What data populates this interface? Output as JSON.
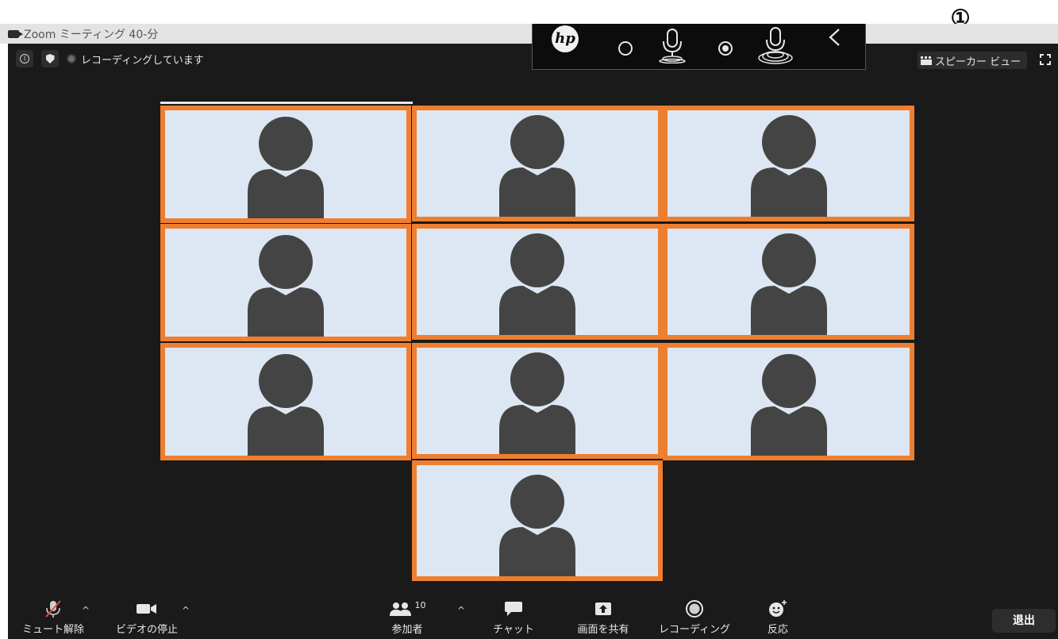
{
  "annotation": {
    "marker": "①"
  },
  "window": {
    "title": "Zoom ミーティング 40-分"
  },
  "status_bar": {
    "recording_text": "レコーディングしています"
  },
  "hp_toolbar": {
    "logo_text": "hp"
  },
  "view_controls": {
    "speaker_view_label": "スピーカー ビュー"
  },
  "participants_grid": {
    "tile_count": 10,
    "colors": {
      "tile_border": "#ee7f30",
      "tile_background": "#dde7f3",
      "avatar": "#444444"
    }
  },
  "toolbar": {
    "unmute_label": "ミュート解除",
    "stop_video_label": "ビデオの停止",
    "participants_label": "参加者",
    "participants_count": "10",
    "chat_label": "チャット",
    "share_screen_label": "画面を共有",
    "record_label": "レコーディング",
    "reactions_label": "反応",
    "leave_label": "退出"
  },
  "icons": [
    "camera-icon",
    "info-icon",
    "shield-icon",
    "recording-dot-icon",
    "hp-logo-icon",
    "circle-outline-icon",
    "microphone-icon",
    "radio-dot-icon",
    "microphone-waves-icon",
    "chevron-left-icon",
    "grid-view-icon",
    "fullscreen-icon",
    "muted-microphone-icon",
    "video-camera-icon",
    "participants-icon",
    "chat-bubble-icon",
    "share-arrow-icon",
    "record-icon",
    "emoji-plus-icon"
  ],
  "colors": {
    "accent": "#ee7f30",
    "app_background": "#1a1a1a",
    "title_bar": "#e3e3e3"
  }
}
